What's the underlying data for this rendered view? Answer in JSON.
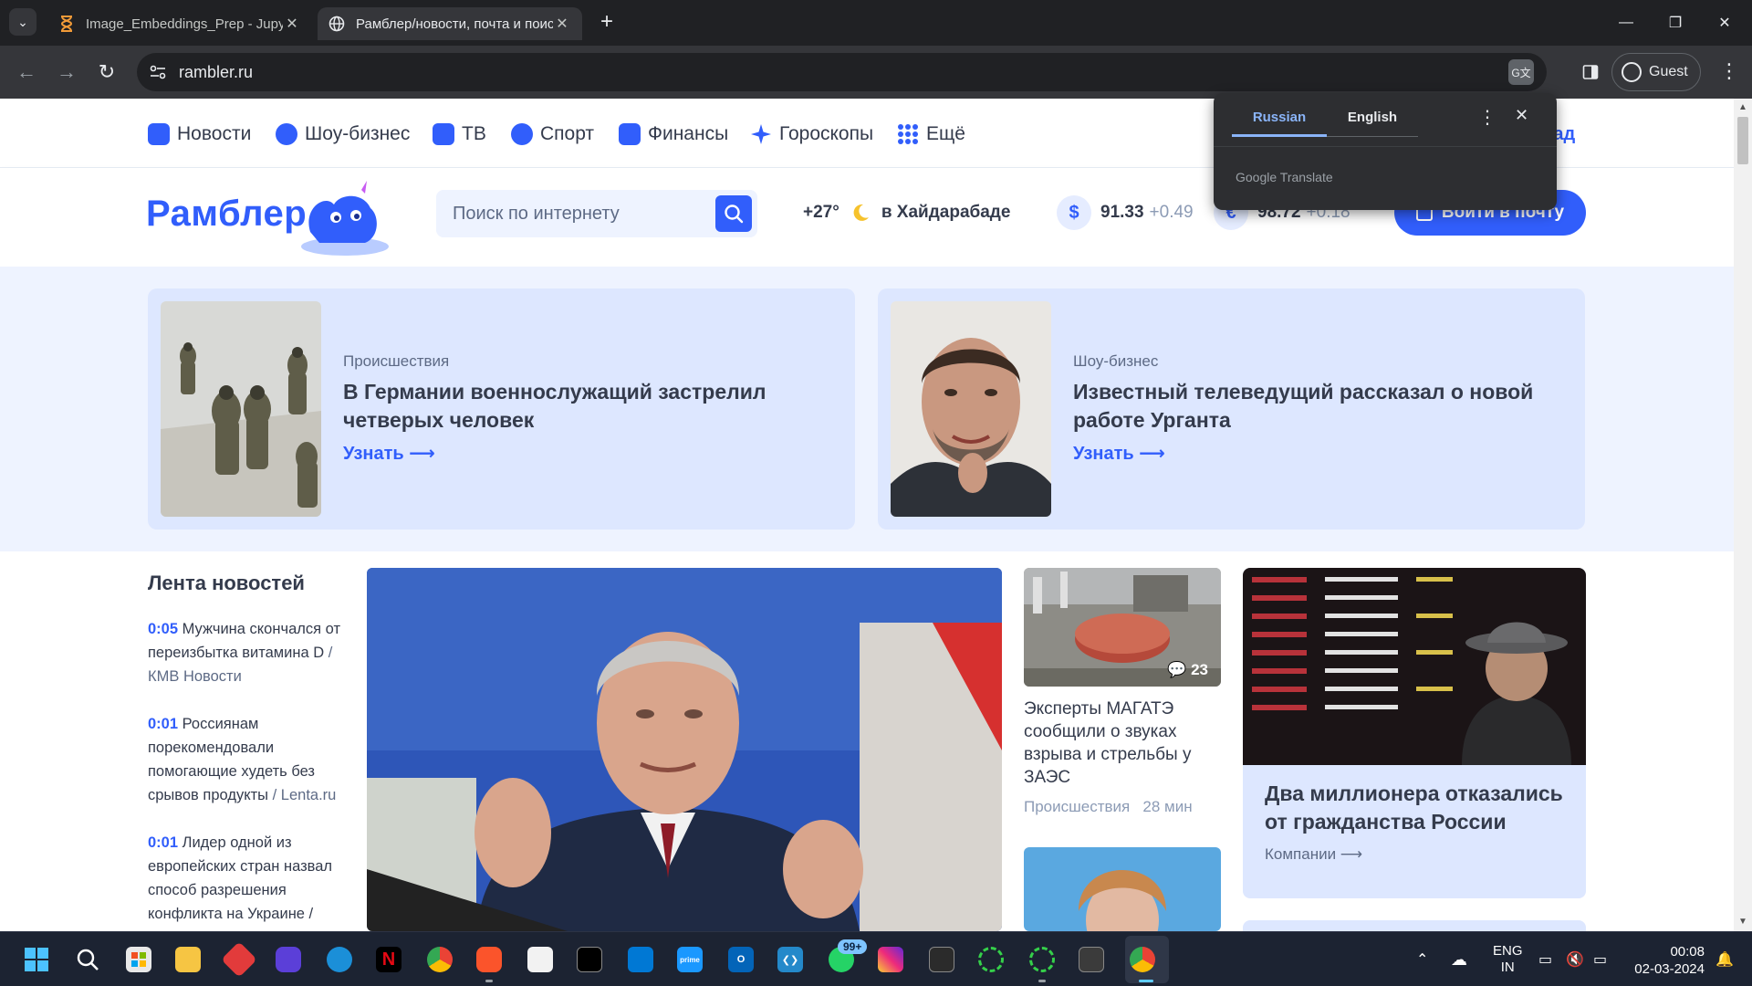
{
  "browser": {
    "tabs": [
      {
        "title": "Image_Embeddings_Prep - Jupyter",
        "icon": "hourglass-icon",
        "active": false
      },
      {
        "title": "Рамблер/новости, почта и поиск",
        "icon": "globe-icon",
        "active": true
      }
    ],
    "new_tab": "+",
    "url": "rambler.ru",
    "profile": "Guest"
  },
  "translate_popup": {
    "source_lang": "Russian",
    "target_lang": "English",
    "brand": "Google Translate"
  },
  "site": {
    "nav": [
      {
        "label": "Новости",
        "color": "#315efb"
      },
      {
        "label": "Шоу-бизнес",
        "color": "#315efb"
      },
      {
        "label": "ТВ",
        "color": "#315efb"
      },
      {
        "label": "Спорт",
        "color": "#315efb"
      },
      {
        "label": "Финансы",
        "color": "#315efb"
      },
      {
        "label": "Гороскопы",
        "color": "#315efb"
      },
      {
        "label": "Ещё",
        "color": "#315efb"
      }
    ],
    "nav_extra": "бад",
    "logo": "Рамблер",
    "search_placeholder": "Поиск по интернету",
    "weather": {
      "temp": "+27°",
      "city": "в Хайдарабаде"
    },
    "currencies": [
      {
        "symbol": "$",
        "value": "91.33",
        "delta": "+0.49"
      },
      {
        "symbol": "€",
        "value": "98.72",
        "delta": "+0.18"
      }
    ],
    "login_button": "Войти в почту",
    "promo": [
      {
        "category": "Происшествия",
        "title": "В Германии военнослужащий застрелил четверых человек",
        "more": "Узнать ⟶"
      },
      {
        "category": "Шоу-бизнес",
        "title": "Известный телеведущий рассказал о новой работе Урганта",
        "more": "Узнать ⟶"
      }
    ],
    "feed": {
      "title": "Лента новостей",
      "items": [
        {
          "time": "0:05",
          "text": "Мужчина скончался от переизбытка витамина D",
          "source": " / КМВ Новости"
        },
        {
          "time": "0:01",
          "text": "Россиянам порекомендовали помогающие худеть без срывов продукты",
          "source": " / Lenta.ru"
        },
        {
          "time": "0:01",
          "text": "Лидер одной из европейских стран назвал способ разрешения конфликта на Украине /",
          "source": ""
        }
      ]
    },
    "mid_news": {
      "comments": "23",
      "title": "Эксперты МАГАТЭ сообщили о звуках взрыва и стрельбы у ЗАЭС",
      "category": "Происшествия",
      "age": "28 мин"
    },
    "right_card": {
      "title": "Два миллионера отказались от гражданства России",
      "tag": "Компании ⟶"
    }
  },
  "taskbar": {
    "tray": {
      "lang1": "ENG",
      "lang2": "IN",
      "time": "00:08",
      "date": "02-03-2024"
    },
    "whatsapp_badge": "99+"
  }
}
